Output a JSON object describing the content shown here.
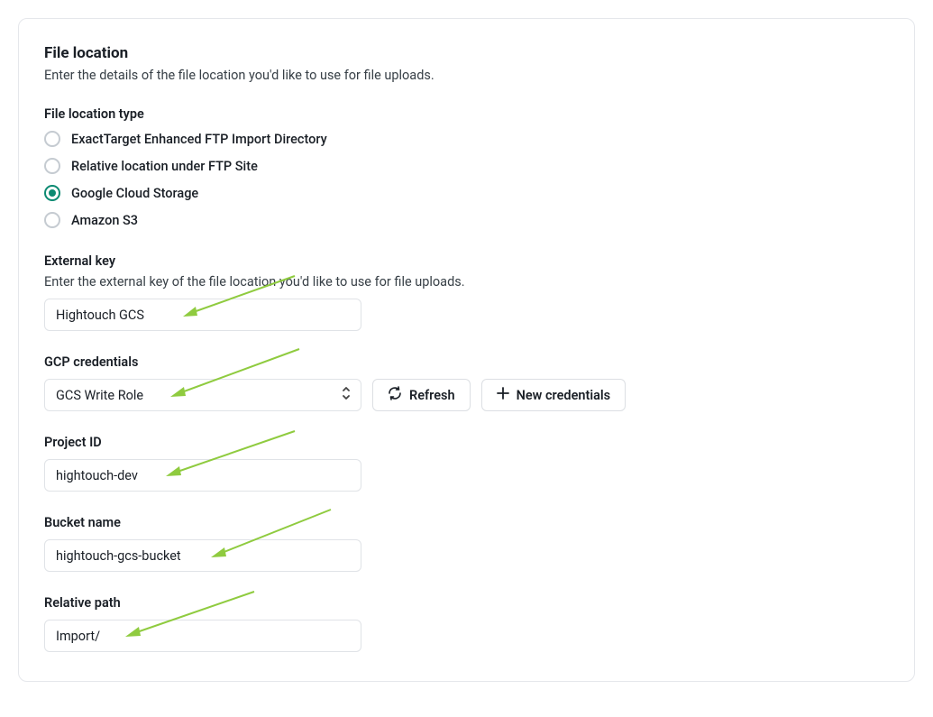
{
  "header": {
    "title": "File location",
    "desc": "Enter the details of the file location you'd like to use for file uploads."
  },
  "file_location_type": {
    "label": "File location type",
    "options": [
      {
        "label": "ExactTarget Enhanced FTP Import Directory",
        "selected": false
      },
      {
        "label": "Relative location under FTP Site",
        "selected": false
      },
      {
        "label": "Google Cloud Storage",
        "selected": true
      },
      {
        "label": "Amazon S3",
        "selected": false
      }
    ]
  },
  "external_key": {
    "label": "External key",
    "desc": "Enter the external key of the file location you'd like to use for file uploads.",
    "value": "Hightouch GCS"
  },
  "gcp_credentials": {
    "label": "GCP credentials",
    "value": "GCS Write Role",
    "refresh_label": "Refresh",
    "new_label": "New credentials"
  },
  "project_id": {
    "label": "Project ID",
    "value": "hightouch-dev"
  },
  "bucket_name": {
    "label": "Bucket name",
    "value": "hightouch-gcs-bucket"
  },
  "relative_path": {
    "label": "Relative path",
    "value": "Import/"
  },
  "colors": {
    "accent_arrow": "#8fcb3f"
  }
}
